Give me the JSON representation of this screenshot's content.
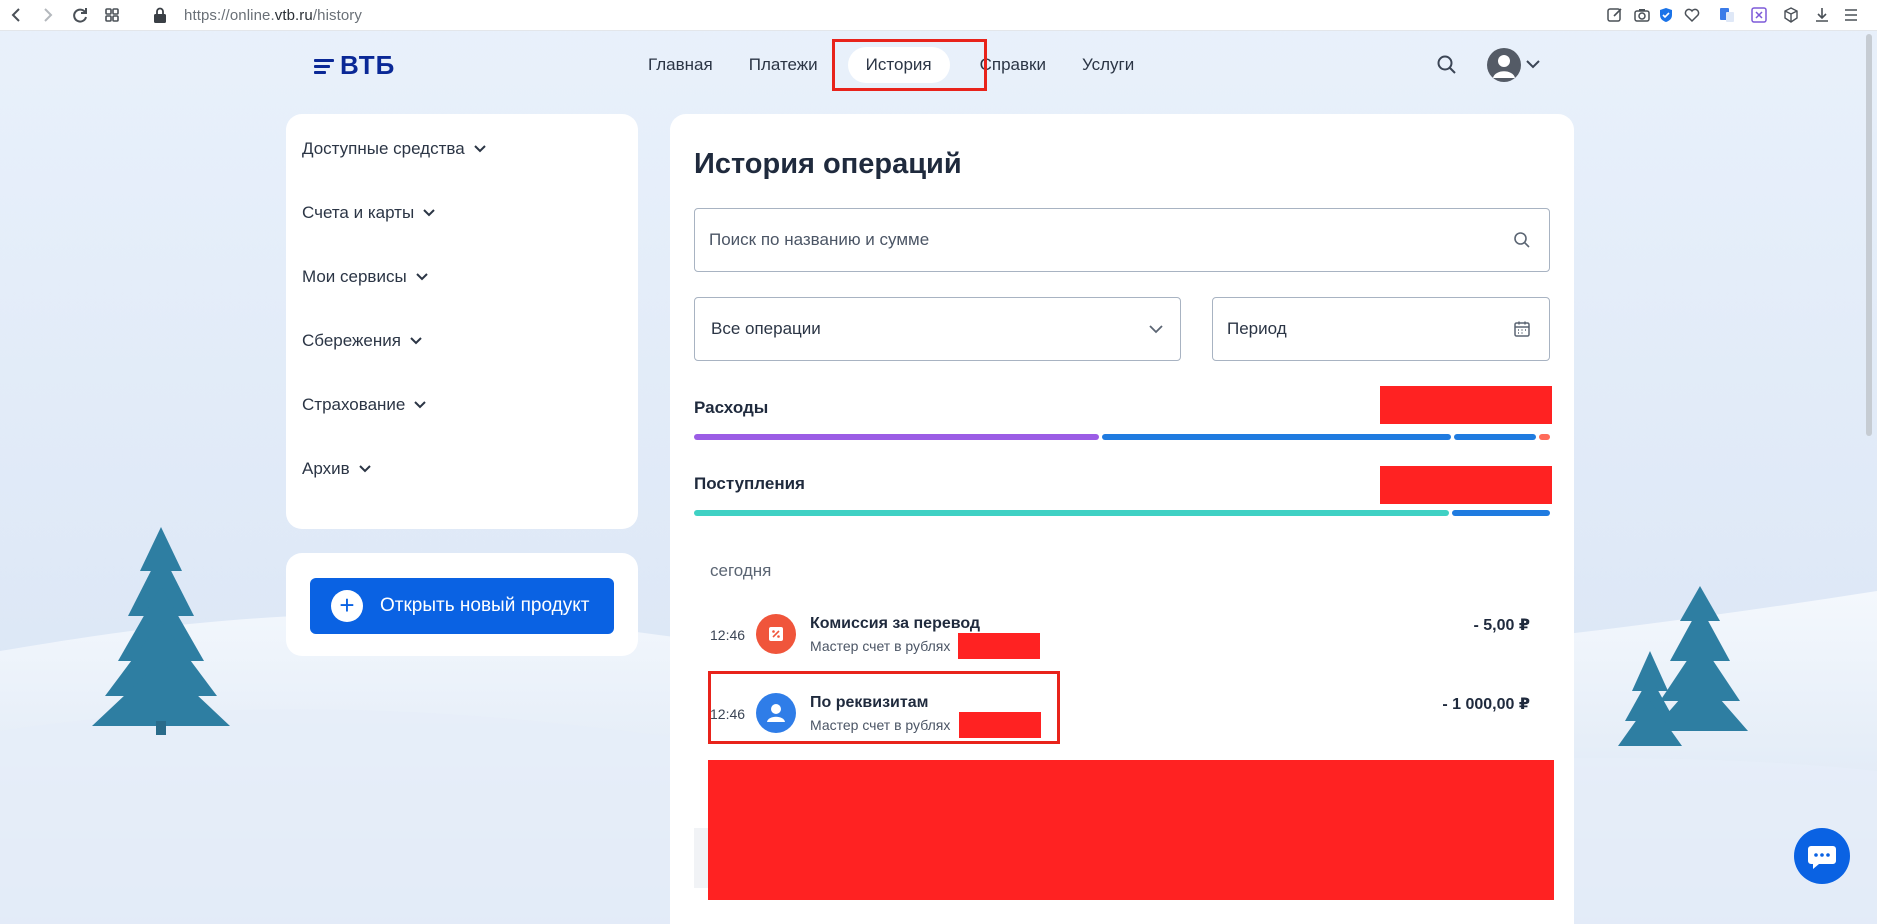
{
  "browser": {
    "url_prefix": "https://online.",
    "url_host": "vtb.ru",
    "url_path": "/history"
  },
  "brand": {
    "logo_text": "ВТБ",
    "color": "#0a2896"
  },
  "nav": {
    "items": [
      "Главная",
      "Платежи",
      "История",
      "Справки",
      "Услуги"
    ],
    "active": "История"
  },
  "sidebar": {
    "items": [
      {
        "label": "Доступные средства"
      },
      {
        "label": "Счета и карты"
      },
      {
        "label": "Мои сервисы"
      },
      {
        "label": "Сбережения"
      },
      {
        "label": "Страхование"
      },
      {
        "label": "Архив"
      }
    ],
    "open_product_label": "Открыть новый продукт"
  },
  "main": {
    "title": "История операций",
    "search_placeholder": "Поиск по названию и сумме",
    "filter_selected": "Все операции",
    "period_label": "Период",
    "expenses_label": "Расходы",
    "income_label": "Поступления",
    "expenses_bar": [
      {
        "share": 0.478,
        "color": "#9b5de5"
      },
      {
        "share": 0.412,
        "color": "#1f7be0"
      },
      {
        "share": 0.097,
        "color": "#1f7be0"
      },
      {
        "share": 0.013,
        "color": "#ff6b5a"
      }
    ],
    "income_bar": [
      {
        "share": 0.885,
        "color": "#3fd1c4"
      },
      {
        "share": 0.115,
        "color": "#1f7be0"
      }
    ],
    "day_label": "сегодня",
    "operations": [
      {
        "time": "12:46",
        "title": "Комиссия за перевод",
        "subtitle": "Мастер счет в рублях",
        "amount": "- 5,00 ₽",
        "icon": "percent-icon",
        "icon_color": "#f0553b"
      },
      {
        "time": "12:46",
        "title": "По реквизитам",
        "subtitle": "Мастер счет в рублях",
        "amount": "- 1 000,00 ₽",
        "icon": "person-icon",
        "icon_color": "#2f7de8"
      }
    ]
  },
  "colors": {
    "accent": "#0a62e3",
    "annotation": "#e8231b",
    "redaction": "#ff2222"
  }
}
